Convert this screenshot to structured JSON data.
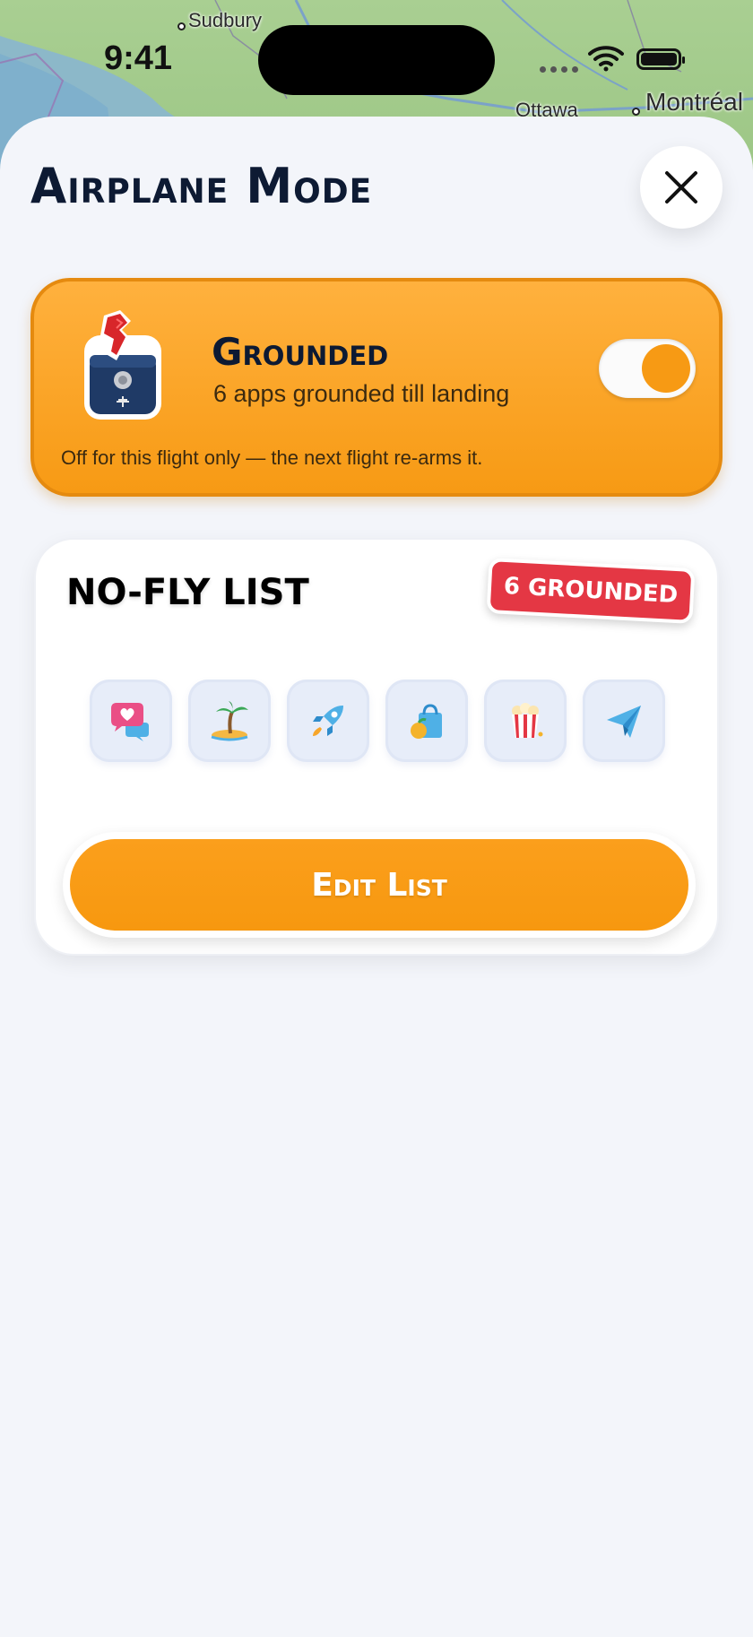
{
  "map": {
    "labels": [
      "Sudbury",
      "Ottawa",
      "Montréal"
    ]
  },
  "status_bar": {
    "time": "9:41"
  },
  "sheet": {
    "title": "Airplane Mode",
    "close_icon": "close-icon"
  },
  "grounded_card": {
    "title": "Grounded",
    "subtitle": "6 apps grounded till landing",
    "note": "Off for this flight only — the next flight re-arms it.",
    "toggle_on": true,
    "accent": "#f79a14"
  },
  "nofly_card": {
    "title": "NO-FLY LIST",
    "badge": "6 GROUNDED",
    "badge_color": "#e43744",
    "apps": [
      {
        "icon": "chat-heart-icon"
      },
      {
        "icon": "island-palm-icon"
      },
      {
        "icon": "rocket-icon"
      },
      {
        "icon": "shopping-bag-icon"
      },
      {
        "icon": "popcorn-icon"
      },
      {
        "icon": "paper-plane-icon"
      }
    ],
    "edit_button": "Edit List"
  }
}
